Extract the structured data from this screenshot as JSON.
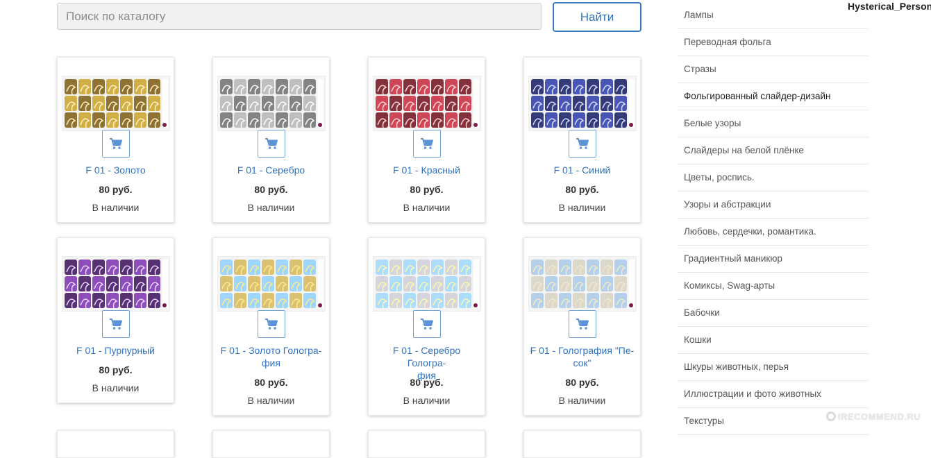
{
  "search": {
    "placeholder": "Поиск по каталогу",
    "button_label": "Найти"
  },
  "user": {
    "name": "Hysterical_Person"
  },
  "watermark": "IRECOMMEND.RU",
  "colors": {
    "link": "#2f73bf",
    "cart_border": "#6ea3de",
    "cart_icon": "#5b93d6"
  },
  "products": [
    {
      "name": "F 01 - Золото",
      "price": "80 руб.",
      "stock": "В наличии",
      "tone": "gold"
    },
    {
      "name": "F 01 - Серебро",
      "price": "80 руб.",
      "stock": "В наличии",
      "tone": "silver"
    },
    {
      "name": "F 01 - Красный",
      "price": "80 руб.",
      "stock": "В наличии",
      "tone": "red"
    },
    {
      "name": "F 01 - Синий",
      "price": "80 руб.",
      "stock": "В наличии",
      "tone": "blue"
    },
    {
      "name": "F 01 - Пурпурный",
      "price": "80 руб.",
      "stock": "В наличии",
      "tone": "purple"
    },
    {
      "name": "F 01 - Золото Голографія",
      "price": "80 руб.",
      "stock": "В наличии",
      "tone": "holo-gold"
    },
    {
      "name": "F 01 - Серебро Голография",
      "price": "80 руб.",
      "stock": "В наличии",
      "tone": "holo-silver"
    },
    {
      "name": "F 01 - Голография \"Песок\"",
      "price": "80 руб.",
      "stock": "В наличии",
      "tone": "holo-sand"
    }
  ],
  "product_name_lines": [
    [
      "F 01 - Золото"
    ],
    [
      "F 01 - Серебро"
    ],
    [
      "F 01 - Красный"
    ],
    [
      "F 01 - Синий"
    ],
    [
      "F 01 - Пурпурный"
    ],
    [
      "F 01 - Золото Голографи-",
      "фия"
    ],
    [
      "F 01 - Серебро Голографи-",
      "фия"
    ],
    [
      "F 01 - Голография \"Пе-",
      "сок\""
    ]
  ],
  "categories": [
    {
      "label": "Лампы"
    },
    {
      "label": "Переводная фольга"
    },
    {
      "label": "Стразы"
    },
    {
      "label": "Фольгированный слайдер-дизайн",
      "active": true
    },
    {
      "label": "Белые узоры"
    },
    {
      "label": "Слайдеры на белой плёнке"
    },
    {
      "label": "Цветы, роспись."
    },
    {
      "label": "Узоры и абстракции"
    },
    {
      "label": "Любовь, сердечки, романтика."
    },
    {
      "label": "Градиентный маникюр"
    },
    {
      "label": "Комиксы, Swag-арты"
    },
    {
      "label": "Бабочки"
    },
    {
      "label": "Кошки"
    },
    {
      "label": "Шкуры животных, перья"
    },
    {
      "label": "Иллюстрации и фото животных"
    },
    {
      "label": "Текстуры"
    }
  ]
}
